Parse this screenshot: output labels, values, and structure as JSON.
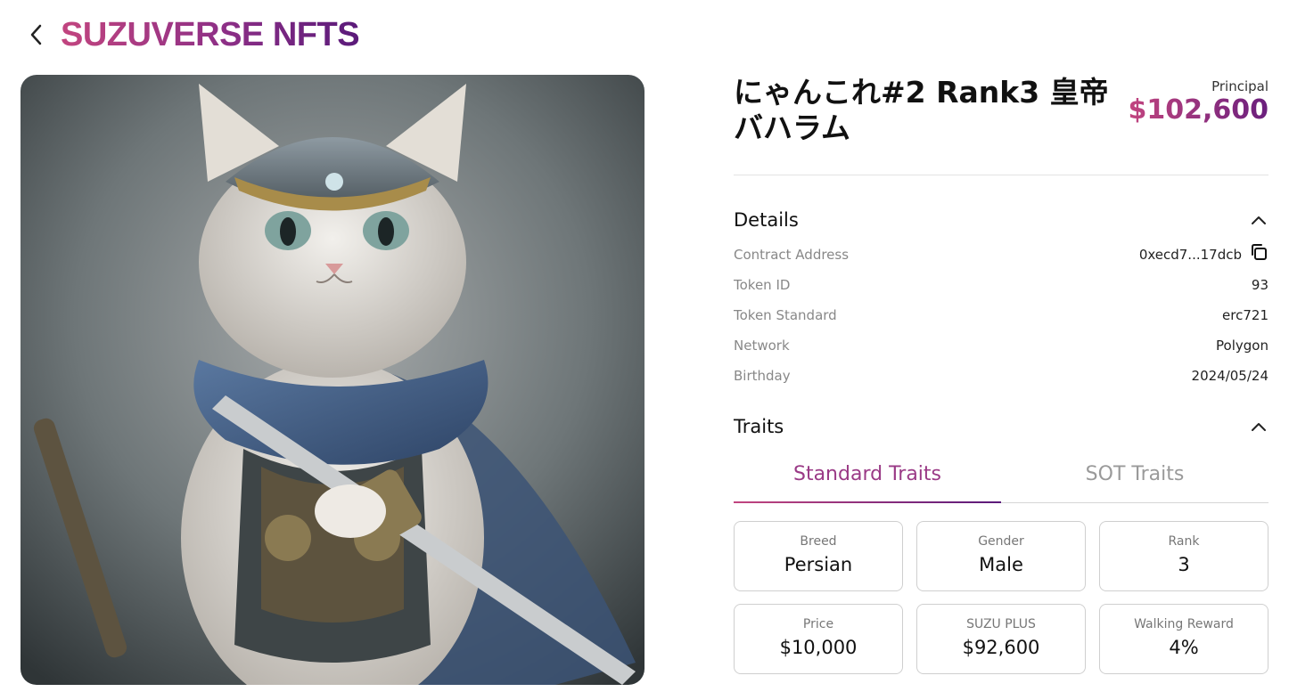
{
  "header": {
    "brand": "SUZUVERSE NFTS",
    "back_icon": "chevron-left-icon"
  },
  "nft": {
    "title": "にゃんこれ#2 Rank3 皇帝バハラム",
    "principal_label": "Principal",
    "principal_value": "$102,600"
  },
  "details": {
    "title": "Details",
    "rows": [
      {
        "label": "Contract Address",
        "value": "0xecd7...17dcb"
      },
      {
        "label": "Token ID",
        "value": "93"
      },
      {
        "label": "Token Standard",
        "value": "erc721"
      },
      {
        "label": "Network",
        "value": "Polygon"
      },
      {
        "label": "Birthday",
        "value": "2024/05/24"
      }
    ]
  },
  "traits": {
    "title": "Traits",
    "tabs": [
      {
        "label": "Standard Traits",
        "active": true
      },
      {
        "label": "SOT Traits",
        "active": false
      }
    ],
    "cards": [
      {
        "label": "Breed",
        "value": "Persian"
      },
      {
        "label": "Gender",
        "value": "Male"
      },
      {
        "label": "Rank",
        "value": "3"
      },
      {
        "label": "Price",
        "value": "$10,000"
      },
      {
        "label": "SUZU PLUS",
        "value": "$92,600"
      },
      {
        "label": "Walking Reward",
        "value": "4%"
      }
    ]
  },
  "colors": {
    "brand_start": "#c2457f",
    "brand_end": "#5a1a7a",
    "tab_active": "#9a3a86"
  }
}
